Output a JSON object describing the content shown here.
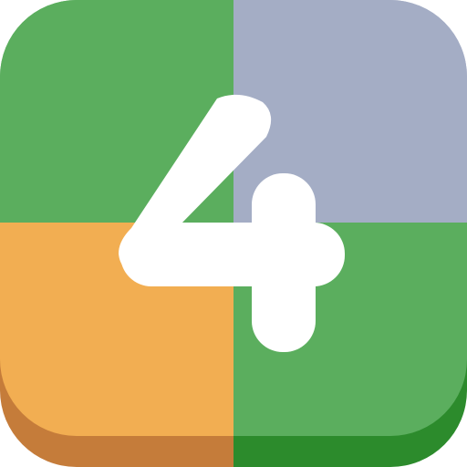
{
  "icon": {
    "digit": "4",
    "colors": {
      "top_left": "#5BAE5E",
      "top_right": "#A4ADC5",
      "bottom_left": "#F2AE52",
      "bottom_right": "#5BAE5E",
      "bottom_edge_left": "#C57C3A",
      "bottom_edge_right": "#2C8B2C",
      "digit": "#FFFFFF"
    }
  }
}
